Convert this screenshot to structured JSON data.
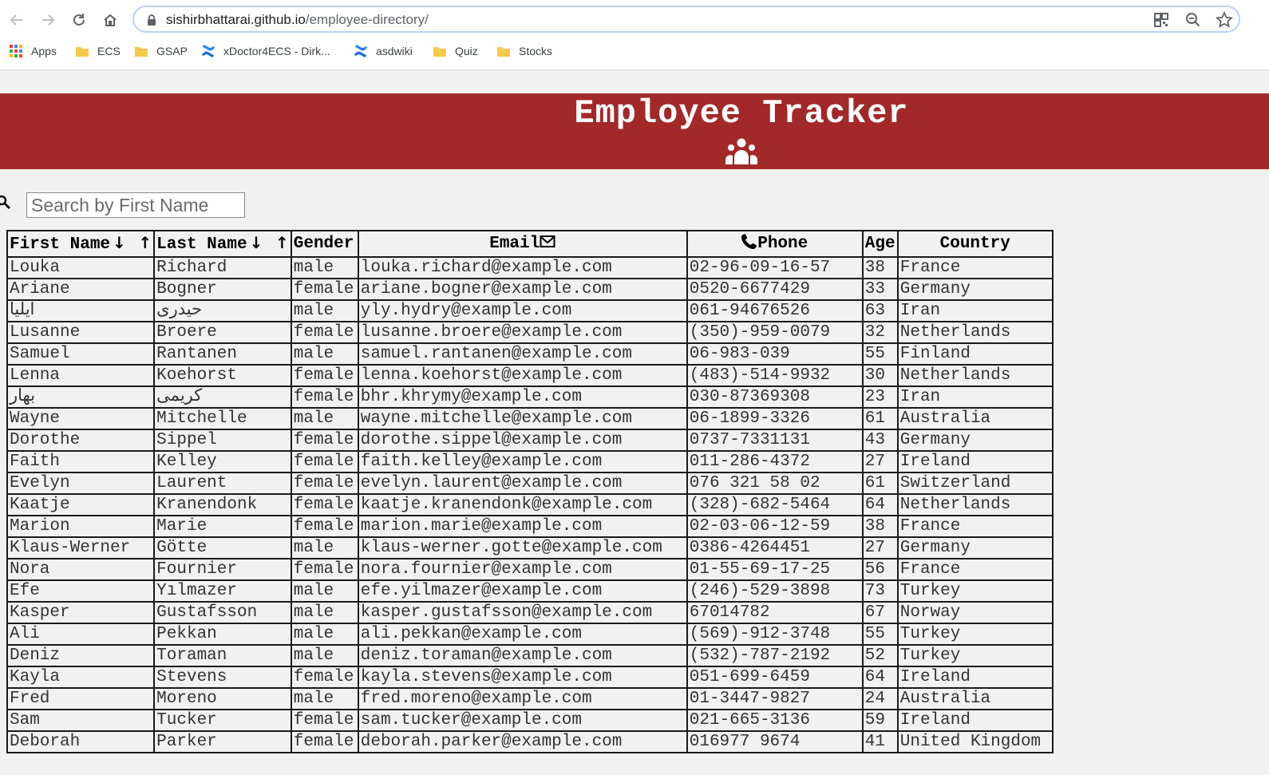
{
  "browser": {
    "url_host": "sishirbhattarai.github.io",
    "url_path": "/employee-directory/",
    "bookmarks": [
      {
        "label": "Apps",
        "icon": "apps-grid-icon"
      },
      {
        "label": "ECS",
        "icon": "folder-icon"
      },
      {
        "label": "GSAP",
        "icon": "folder-icon"
      },
      {
        "label": "xDoctor4ECS - Dirk...",
        "icon": "confluence-icon"
      },
      {
        "label": "asdwiki",
        "icon": "confluence-icon"
      },
      {
        "label": "Quiz",
        "icon": "folder-icon"
      },
      {
        "label": "Stocks",
        "icon": "folder-icon"
      }
    ]
  },
  "header": {
    "title": "Employee Tracker",
    "icon": "people-group-icon",
    "background": "#a3282a"
  },
  "search": {
    "placeholder": "Search by First Name",
    "value": ""
  },
  "table": {
    "headers": {
      "first_name": "First Name",
      "last_name": "Last Name",
      "gender": "Gender",
      "email": "Email",
      "phone": "Phone",
      "age": "Age",
      "country": "Country"
    },
    "sort_down": "↓",
    "sort_up": "↑",
    "rows": [
      [
        "Louka",
        "Richard",
        "male",
        "louka.richard@example.com",
        "02-96-09-16-57",
        "38",
        "France"
      ],
      [
        "Ariane",
        "Bogner",
        "female",
        "ariane.bogner@example.com",
        "0520-6677429",
        "33",
        "Germany"
      ],
      [
        "ایلیا",
        "حیدری",
        "male",
        "yly.hydry@example.com",
        "061-94676526",
        "63",
        "Iran"
      ],
      [
        "Lusanne",
        "Broere",
        "female",
        "lusanne.broere@example.com",
        "(350)-959-0079",
        "32",
        "Netherlands"
      ],
      [
        "Samuel",
        "Rantanen",
        "male",
        "samuel.rantanen@example.com",
        "06-983-039",
        "55",
        "Finland"
      ],
      [
        "Lenna",
        "Koehorst",
        "female",
        "lenna.koehorst@example.com",
        "(483)-514-9932",
        "30",
        "Netherlands"
      ],
      [
        "بهار",
        "کریمی",
        "female",
        "bhr.khrymy@example.com",
        "030-87369308",
        "23",
        "Iran"
      ],
      [
        "Wayne",
        "Mitchelle",
        "male",
        "wayne.mitchelle@example.com",
        "06-1899-3326",
        "61",
        "Australia"
      ],
      [
        "Dorothe",
        "Sippel",
        "female",
        "dorothe.sippel@example.com",
        "0737-7331131",
        "43",
        "Germany"
      ],
      [
        "Faith",
        "Kelley",
        "female",
        "faith.kelley@example.com",
        "011-286-4372",
        "27",
        "Ireland"
      ],
      [
        "Evelyn",
        "Laurent",
        "female",
        "evelyn.laurent@example.com",
        "076 321 58 02",
        "61",
        "Switzerland"
      ],
      [
        "Kaatje",
        "Kranendonk",
        "female",
        "kaatje.kranendonk@example.com",
        "(328)-682-5464",
        "64",
        "Netherlands"
      ],
      [
        "Marion",
        "Marie",
        "female",
        "marion.marie@example.com",
        "02-03-06-12-59",
        "38",
        "France"
      ],
      [
        "Klaus-Werner",
        "Götte",
        "male",
        "klaus-werner.gotte@example.com",
        "0386-4264451",
        "27",
        "Germany"
      ],
      [
        "Nora",
        "Fournier",
        "female",
        "nora.fournier@example.com",
        "01-55-69-17-25",
        "56",
        "France"
      ],
      [
        "Efe",
        "Yılmazer",
        "male",
        "efe.yilmazer@example.com",
        "(246)-529-3898",
        "73",
        "Turkey"
      ],
      [
        "Kasper",
        "Gustafsson",
        "male",
        "kasper.gustafsson@example.com",
        "67014782",
        "67",
        "Norway"
      ],
      [
        "Ali",
        "Pekkan",
        "male",
        "ali.pekkan@example.com",
        "(569)-912-3748",
        "55",
        "Turkey"
      ],
      [
        "Deniz",
        "Toraman",
        "male",
        "deniz.toraman@example.com",
        "(532)-787-2192",
        "52",
        "Turkey"
      ],
      [
        "Kayla",
        "Stevens",
        "female",
        "kayla.stevens@example.com",
        "051-699-6459",
        "64",
        "Ireland"
      ],
      [
        "Fred",
        "Moreno",
        "male",
        "fred.moreno@example.com",
        "01-3447-9827",
        "24",
        "Australia"
      ],
      [
        "Sam",
        "Tucker",
        "female",
        "sam.tucker@example.com",
        "021-665-3136",
        "59",
        "Ireland"
      ],
      [
        "Deborah",
        "Parker",
        "female",
        "deborah.parker@example.com",
        "016977 9674",
        "41",
        "United Kingdom"
      ]
    ]
  }
}
